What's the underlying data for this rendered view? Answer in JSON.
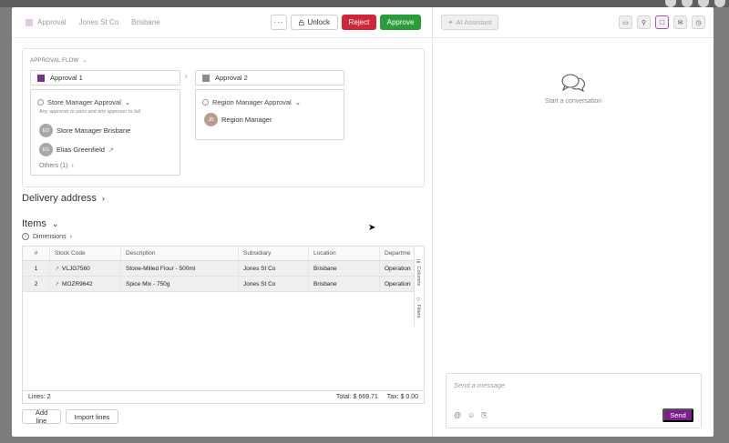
{
  "header": {
    "crumbs": [
      "Approval",
      "Jones St Co",
      "Brisbane"
    ],
    "more_label": "···",
    "unlock_label": "Unlock",
    "reject_label": "Reject",
    "approve_label": "Approve"
  },
  "approval_flow": {
    "title": "APPROVAL FLOW",
    "stage1": {
      "label": "Approval 1",
      "color": "#7b2d8a",
      "card_title": "Store Manager Approval",
      "card_sub": "Any approver to pass and any approver to fail",
      "people": [
        {
          "initials": "ED",
          "name": "Store Manager Brisbane"
        },
        {
          "initials": "EG",
          "name": "Elias Greenfield"
        }
      ],
      "others": "Others (1)"
    },
    "stage2": {
      "label": "Approval 2",
      "color": "#8c8c8c",
      "card_title": "Region Manager Approval",
      "people": [
        {
          "initials": "JB",
          "name": "Region Manager"
        }
      ]
    }
  },
  "delivery": {
    "title": "Delivery address"
  },
  "items": {
    "title": "Items",
    "dimensions_label": "Dimensions",
    "columns": [
      "#",
      "Stock Code",
      "Description",
      "Subsidiary",
      "Location",
      "Departme"
    ],
    "rows": [
      {
        "num": "1",
        "code": "VLJG7560",
        "desc": "Stone-Milled Flour - 500ml",
        "sub": "Jones St Co",
        "loc": "Brisbane",
        "dept": "Operations"
      },
      {
        "num": "2",
        "code": "MOZR9642",
        "desc": "Spice Mix - 750g",
        "sub": "Jones St Co",
        "loc": "Brisbane",
        "dept": "Operations"
      }
    ],
    "side_tabs": [
      "Columns",
      "Filters"
    ],
    "lines": "Lines: 2",
    "total": "Total: $ 669.71",
    "tax": "Tax: $ 0.00",
    "add_line_label": "Add line",
    "import_lines_label": "Import lines"
  },
  "chat": {
    "ai_label": "AI Assistant",
    "empty_text": "Start a conversation",
    "placeholder": "Send a message",
    "send_label": "Send"
  }
}
